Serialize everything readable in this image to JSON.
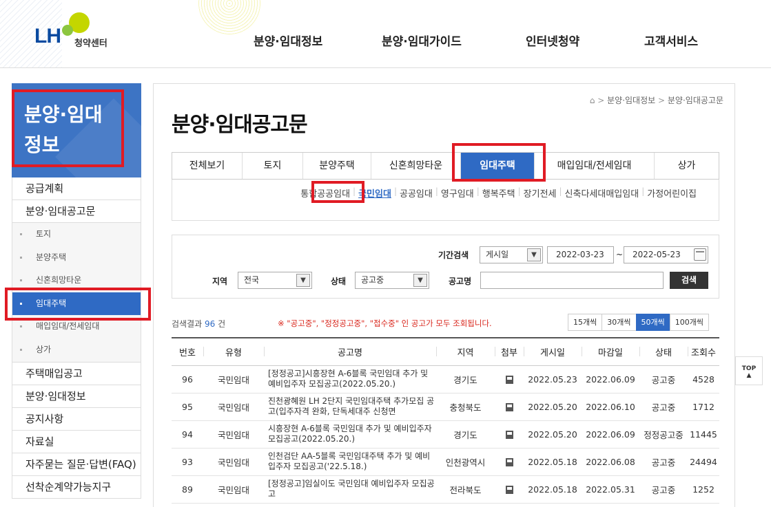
{
  "header": {
    "logo_text": "LH",
    "logo_sub": "청약센터",
    "nav": [
      "분양·임대정보",
      "분양·임대가이드",
      "인터넷청약",
      "고객서비스"
    ]
  },
  "lnb": {
    "title": "분양·임대\n정보",
    "items_top": [
      "공급계획",
      "분양·임대공고문"
    ],
    "sub_items": [
      "토지",
      "분양주택",
      "신혼희망타운",
      "임대주택",
      "매입임대/전세임대",
      "상가"
    ],
    "active_sub": "임대주택",
    "items_bottom": [
      "주택매입공고",
      "분양·임대정보",
      "공지사항",
      "자료실",
      "자주묻는 질문·답변(FAQ)",
      "선착순계약가능지구"
    ]
  },
  "breadcrumb": [
    "분양·임대정보",
    "분양·임대공고문"
  ],
  "page_title": "분양·임대공고문",
  "tabs": [
    "전체보기",
    "토지",
    "분양주택",
    "신혼희망타운",
    "임대주택",
    "매입임대/전세임대",
    "상가"
  ],
  "active_tab": "임대주택",
  "subtabs": [
    "통합공공임대",
    "국민임대",
    "공공임대",
    "영구임대",
    "행복주택",
    "장기전세",
    "신축다세대매입임대",
    "가정어린이집"
  ],
  "active_subtab": "국민임대",
  "search": {
    "period_label": "기간검색",
    "period_type": "게시일",
    "date_from": "2022-03-23",
    "date_sep": "~",
    "date_to": "2022-05-23",
    "region_label": "지역",
    "region_value": "전국",
    "status_label": "상태",
    "status_value": "공고중",
    "name_label": "공고명",
    "name_value": "",
    "search_button": "검색"
  },
  "results": {
    "prefix": "검색결과",
    "count": "96",
    "suffix": "건",
    "notice": "※ \"공고중\", \"정정공고중\", \"접수중\" 인 공고가 모두 조회됩니다.",
    "page_sizes": [
      "15개씩",
      "30개씩",
      "50개씩",
      "100개씩"
    ],
    "active_page_size": "50개씩"
  },
  "table": {
    "headers": [
      "번호",
      "유형",
      "공고명",
      "지역",
      "첨부",
      "게시일",
      "마감일",
      "상태",
      "조회수"
    ],
    "rows": [
      {
        "no": "96",
        "type": "국민임대",
        "title": "[정정공고]시흥장현 A-6블록 국민임대 추가 및 예비입주자 모집공고(2022.05.20.)",
        "region": "경기도",
        "posted": "2022.05.23",
        "deadline": "2022.06.09",
        "status": "공고중",
        "views": "4528"
      },
      {
        "no": "95",
        "type": "국민임대",
        "title": "진천광혜원 LH 2단지 국민임대주택 추가모집 공고(입주자격 완화, 단독세대주 신청면",
        "region": "충청북도",
        "posted": "2022.05.20",
        "deadline": "2022.06.10",
        "status": "공고중",
        "views": "1712"
      },
      {
        "no": "94",
        "type": "국민임대",
        "title": "시흥장현 A-6블록 국민임대 추가 및 예비입주자 모집공고(2022.05.20.)",
        "region": "경기도",
        "posted": "2022.05.20",
        "deadline": "2022.06.09",
        "status": "정정공고중",
        "views": "11445"
      },
      {
        "no": "93",
        "type": "국민임대",
        "title": "인천검단 AA-5블록 국민임대주택 추가 및 예비입주자 모집공고('22.5.18.)",
        "region": "인천광역시",
        "posted": "2022.05.18",
        "deadline": "2022.06.08",
        "status": "공고중",
        "views": "24494"
      },
      {
        "no": "89",
        "type": "국민임대",
        "title": "[정정공고]임실이도 국민임대 예비입주자 모집공고",
        "region": "전라북도",
        "posted": "2022.05.18",
        "deadline": "2022.05.31",
        "status": "공고중",
        "views": "1252"
      }
    ]
  },
  "top_button": "TOP",
  "colors": {
    "primary": "#2f6ac4",
    "highlight": "#e01b24",
    "notice": "#d9261c"
  }
}
